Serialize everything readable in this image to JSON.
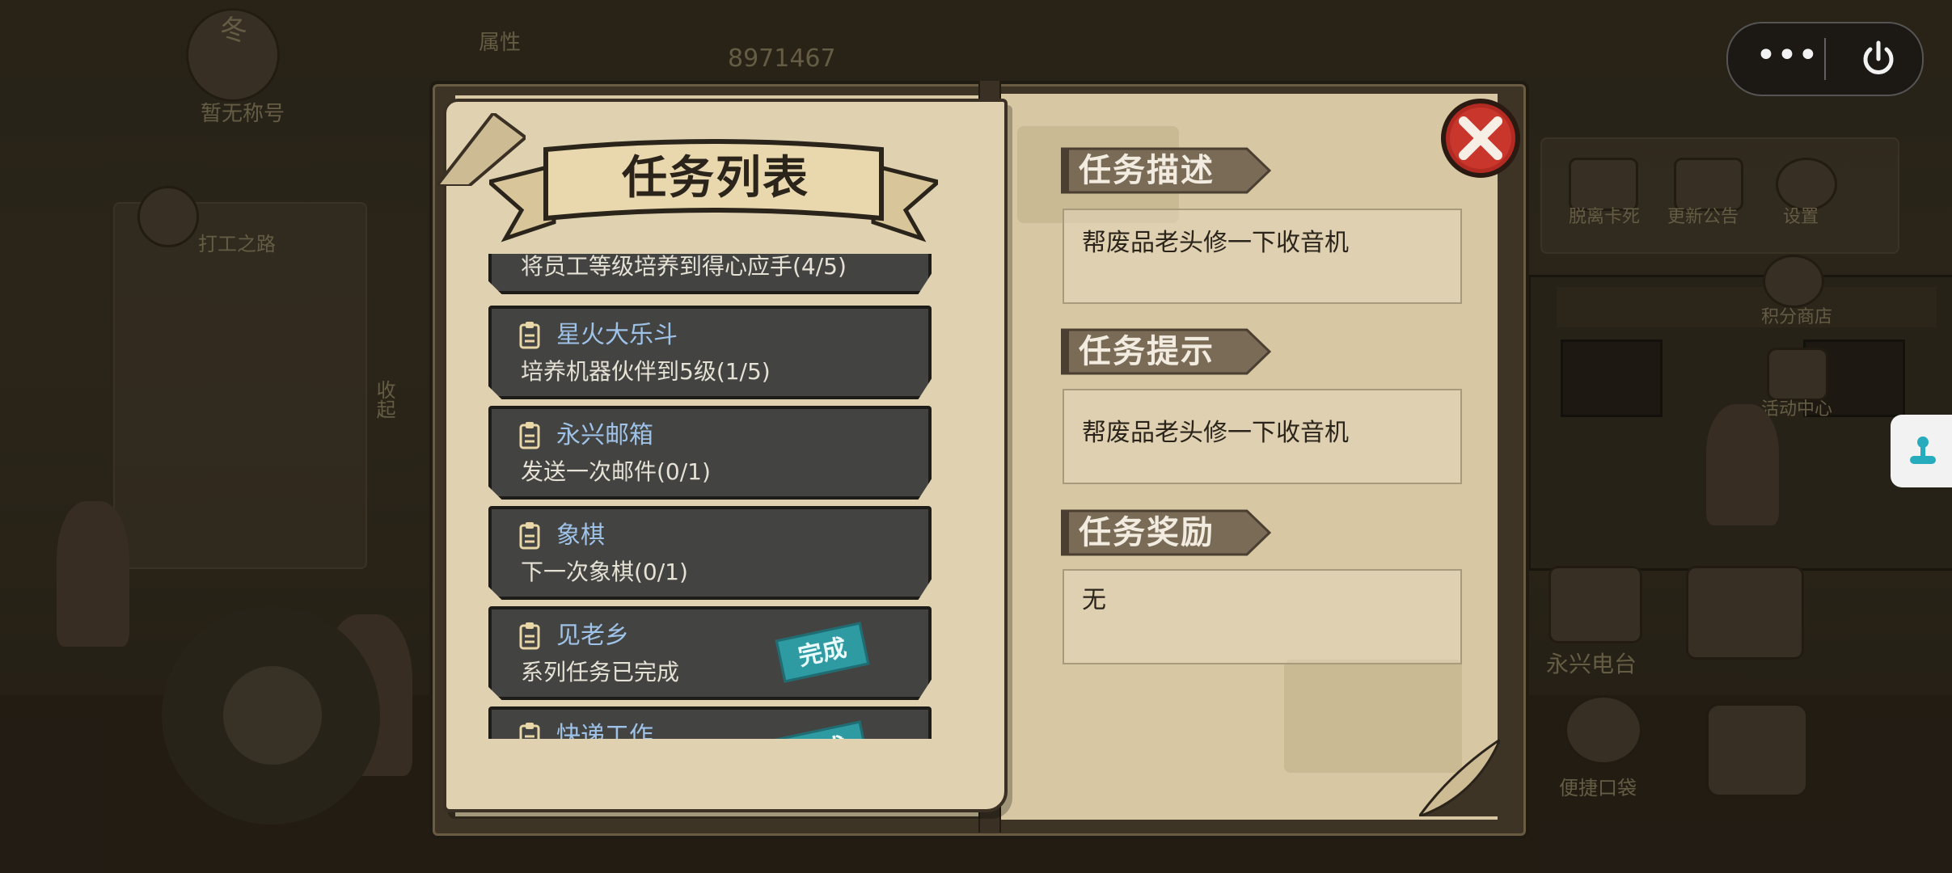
{
  "modal": {
    "title": "任务列表",
    "close_icon": "close-x-icon"
  },
  "tasks": [
    {
      "name": "",
      "desc": "将员工等级培养到得心应手(4/5)",
      "completed": false
    },
    {
      "name": "星火大乐斗",
      "desc": "培养机器伙伴到5级(1/5)",
      "completed": false
    },
    {
      "name": "永兴邮箱",
      "desc": "发送一次邮件(0/1)",
      "completed": false
    },
    {
      "name": "象棋",
      "desc": "下一次象棋(0/1)",
      "completed": false
    },
    {
      "name": "见老乡",
      "desc": "系列任务已完成",
      "completed": true,
      "stamp": "完成"
    },
    {
      "name": "快递工作",
      "desc": "",
      "completed": true,
      "stamp": "完成"
    }
  ],
  "sections": {
    "description": {
      "label": "任务描述",
      "content": "帮废品老头修一下收音机"
    },
    "hint": {
      "label": "任务提示",
      "content": "帮废品老头修一下收音机"
    },
    "reward": {
      "label": "任务奖励",
      "content": "无"
    }
  },
  "capsule": {
    "more_icon": "more-dots-icon",
    "power_icon": "power-icon"
  },
  "background": {
    "season": "冬",
    "player_title": "暂无称号",
    "attribute_button": "属性",
    "score": "8971467",
    "menu": [
      {
        "label": "脱离卡死",
        "icon": "unstuck-icon"
      },
      {
        "label": "更新公告",
        "icon": "announcement-icon"
      },
      {
        "label": "设置",
        "icon": "settings-icon"
      },
      {
        "label": "积分商店",
        "icon": "shop-icon"
      },
      {
        "label": "活动中心",
        "icon": "event-icon"
      },
      {
        "label": "永兴电台",
        "icon": "radio-icon"
      },
      {
        "label": "便捷口袋",
        "icon": "pocket-icon"
      }
    ],
    "work_button": "打工之路",
    "collapse_button": "收起",
    "colors": {
      "teal_stamp": "#2e9aa2",
      "task_name": "#9ec2e8",
      "card_bg": "#434341",
      "paper": "#d9c9a5"
    }
  }
}
